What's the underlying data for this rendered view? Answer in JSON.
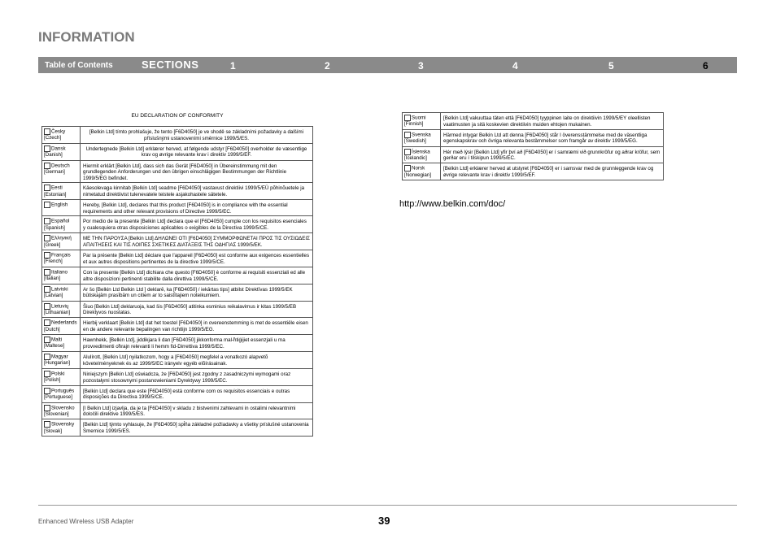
{
  "header": {
    "title": "INFORMATION"
  },
  "nav": {
    "toc_label": "Table of Contents",
    "sections_label": "SECTIONS",
    "numbers": [
      "1",
      "2",
      "3",
      "4",
      "5",
      "6"
    ],
    "active": "6"
  },
  "declaration": {
    "heading": "EU DECLARATION OF CONFORMITY",
    "left_rows": [
      {
        "lang": "Česky [Czech]",
        "text": "[Belkin Ltd] tímto prohlašuje, že tento [F6D4050] je ve shodě se základními požadavky a dalšími příslušnými ustanoveními směrnice 1999/5/ES.",
        "center": true
      },
      {
        "lang": "Dansk [Danish]",
        "text": "Undertegnede [Belkin Ltd] erklærer herved, at følgende udstyr [F6D4050] overholder de væsentlige krav og øvrige relevante krav i direktiv 1999/5/EF.",
        "center": true
      },
      {
        "lang": "Deutsch [German]",
        "text": "Hiermit erklärt [Belkin Ltd], dass sich das Gerät [F6D4050] in Übereinstimmung mit den grundlegenden Anforderungen und den übrigen einschlägigen Bestimmungen der Richtlinie 1999/5/EG befindet.",
        "center": false
      },
      {
        "lang": "Eesti [Estonian]",
        "text": "Käesolevaga kinnitab [Belkin Ltd] seadme [F6D4050] vastavust direktiivi 1999/5/EÜ põhinõuetele ja nimetatud direktiivist tulenevatele teistele asjakohastele sätetele.",
        "center": false
      },
      {
        "lang": "English",
        "text": "Hereby, [Belkin Ltd], declares that this product [F6D4050] is in compliance with the essential requirements and other relevant provisions of Directive 1999/5/EC.",
        "center": false
      },
      {
        "lang": "Español [Spanish]",
        "text": "Por medio de la presente [Belkin Ltd] declara que el [F6D4050] cumple con los requisitos esenciales y cualesquiera otras disposiciones aplicables o exigibles de la Directiva 1999/5/CE.",
        "center": false
      },
      {
        "lang": "Ελληνική [Greek]",
        "text": "ΜΕ ΤΗΝ ΠΑΡΟΥΣΑ [Belkin Ltd] ΔΗΛΩΝΕΙ ΟΤΙ [F6D4050] ΣΥΜΜΟΡΦΩΝΕΤΑΙ ΠΡΟΣ ΤΙΣ ΟΥΣΙΩΔΕΙΣ ΑΠΑΙΤΗΣΕΙΣ ΚΑΙ ΤΙΣ ΛΟΙΠΕΣ ΣΧΕΤΙΚΕΣ ΔΙΑΤΑΞΕΙΣ ΤΗΣ ΟΔΗΓΙΑΣ 1999/5/ΕΚ.",
        "center": false
      },
      {
        "lang": "Français [French]",
        "text": "Par la présente [Belkin Ltd] déclare que l'appareil [F6D4050] est conforme aux exigences essentielles et aux autres dispositions pertinentes de la directive 1999/5/CE.",
        "center": false
      },
      {
        "lang": "Italiano [Italian]",
        "text": "Con la presente [Belkin Ltd] dichiara che questo [F6D4050] è conforme ai requisiti essenziali ed alle altre disposizioni pertinenti stabilite dalla direttiva 1999/5/CE.",
        "center": false
      },
      {
        "lang": "Latviski [Latvian]",
        "text": "Ar šo [Belkin Ltd Belkin Ltd ] deklarē, ka [F6D4050] / iekārtas tips] atbilst Direktīvas 1999/5/EK būtiskajām prasībām un citiem ar to saistītajiem noteikumiem.",
        "center": false
      },
      {
        "lang": "Lietuvių [Lithuanian]",
        "text": "Šiuo [Belkin Ltd] deklaruoja, kad šis [F6D4050] atitinka esminius reikalavimus ir kitas 1999/5/EB Direktyvos nuostatas.",
        "center": false
      },
      {
        "lang": "Nederlands [Dutch]",
        "text": "Hierbij verklaart [Belkin Ltd] dat het toestel [F6D4050] in overeenstemming is met de essentiële eisen en de andere relevante bepalingen van richtlijn 1999/5/EG.",
        "center": false
      },
      {
        "lang": "Malti [Maltese]",
        "text": "Hawnhekk, [Belkin Ltd], jiddikjara li dan [F6D4050] jikkonforma mal-ħtiġijiet essenzjali u ma provvedimenti oħrajn relevanti li hemm fid-Dirrettiva 1999/5/EC.",
        "center": false
      },
      {
        "lang": "Magyar [Hungarian]",
        "text": "Alulírott, [Belkin Ltd] nyilatkozom, hogy a [F6D4050] megfelel a vonatkozó alapvetõ követelményeknek és az 1999/5/EC irányelv egyéb elõírásainak.",
        "center": false
      },
      {
        "lang": "Polski [Polish]",
        "text": "Niniejszym [Belkin Ltd] oświadcza, że [F6D4050] jest zgodny z zasadniczymi wymogami oraz pozostałymi stosownymi postanowieniami Dyrektywy 1999/5/EC.",
        "center": false
      },
      {
        "lang": "Português [Portuguese]",
        "text": "[Belkin Ltd] declara que este [F6D4050] está conforme com os requisitos essenciais e outras disposições da Directiva 1999/5/CE.",
        "center": false
      },
      {
        "lang": "Slovensko [Slovenian]",
        "text": "[I Belkin Ltd] izjavlja, da je ta [F6D4050] v skladu z bistvenimi zahtevami in ostalimi relevantnimi določili direktive 1999/5/ES.",
        "center": false
      },
      {
        "lang": "Slovensky [Slovak]",
        "text": "[Belkin Ltd] týmto vyhlasuje, že [F6D4050] spĺňa základné požiadavky a všetky príslušné ustanovenia Smernice 1999/5/ES.",
        "center": false
      }
    ],
    "right_rows": [
      {
        "lang": "Suomi [Finnish]",
        "text": "[Belkin Ltd] vakuuttaa täten että [F6D4050] tyyppinen laite on direktiivin 1999/5/EY oleellisten vaatimusten ja sitä koskevien direktiivin muiden ehtojen mukainen."
      },
      {
        "lang": "Svenska [Swedish]",
        "text": "Härmed intygar Belkin Ltd att denna [F6D4050] står I överensstämmelse med de väsentliga egenskapskrav och övriga relevanta bestämmelser som framgår av direktiv 1999/5/EG."
      },
      {
        "lang": "Íslenska [Icelandic]",
        "text": "Hér með lýsir [Belkin Ltd] yfir því að [F6D4050] er í samræmi við grunnkröfur og aðrar kröfur, sem gerðar eru í tilskipun 1999/5/EC."
      },
      {
        "lang": "Norsk [Norwegian]",
        "text": "[Belkin Ltd] erklærer herved at utstyret [F6D4050] er i samsvar med de grunnleggende krav og øvrige relevante krav i direktiv 1999/5/EF."
      }
    ]
  },
  "url": "http://www.belkin.com/doc/",
  "footer": {
    "product": "Enhanced Wireless USB Adapter",
    "page_number": "39"
  }
}
